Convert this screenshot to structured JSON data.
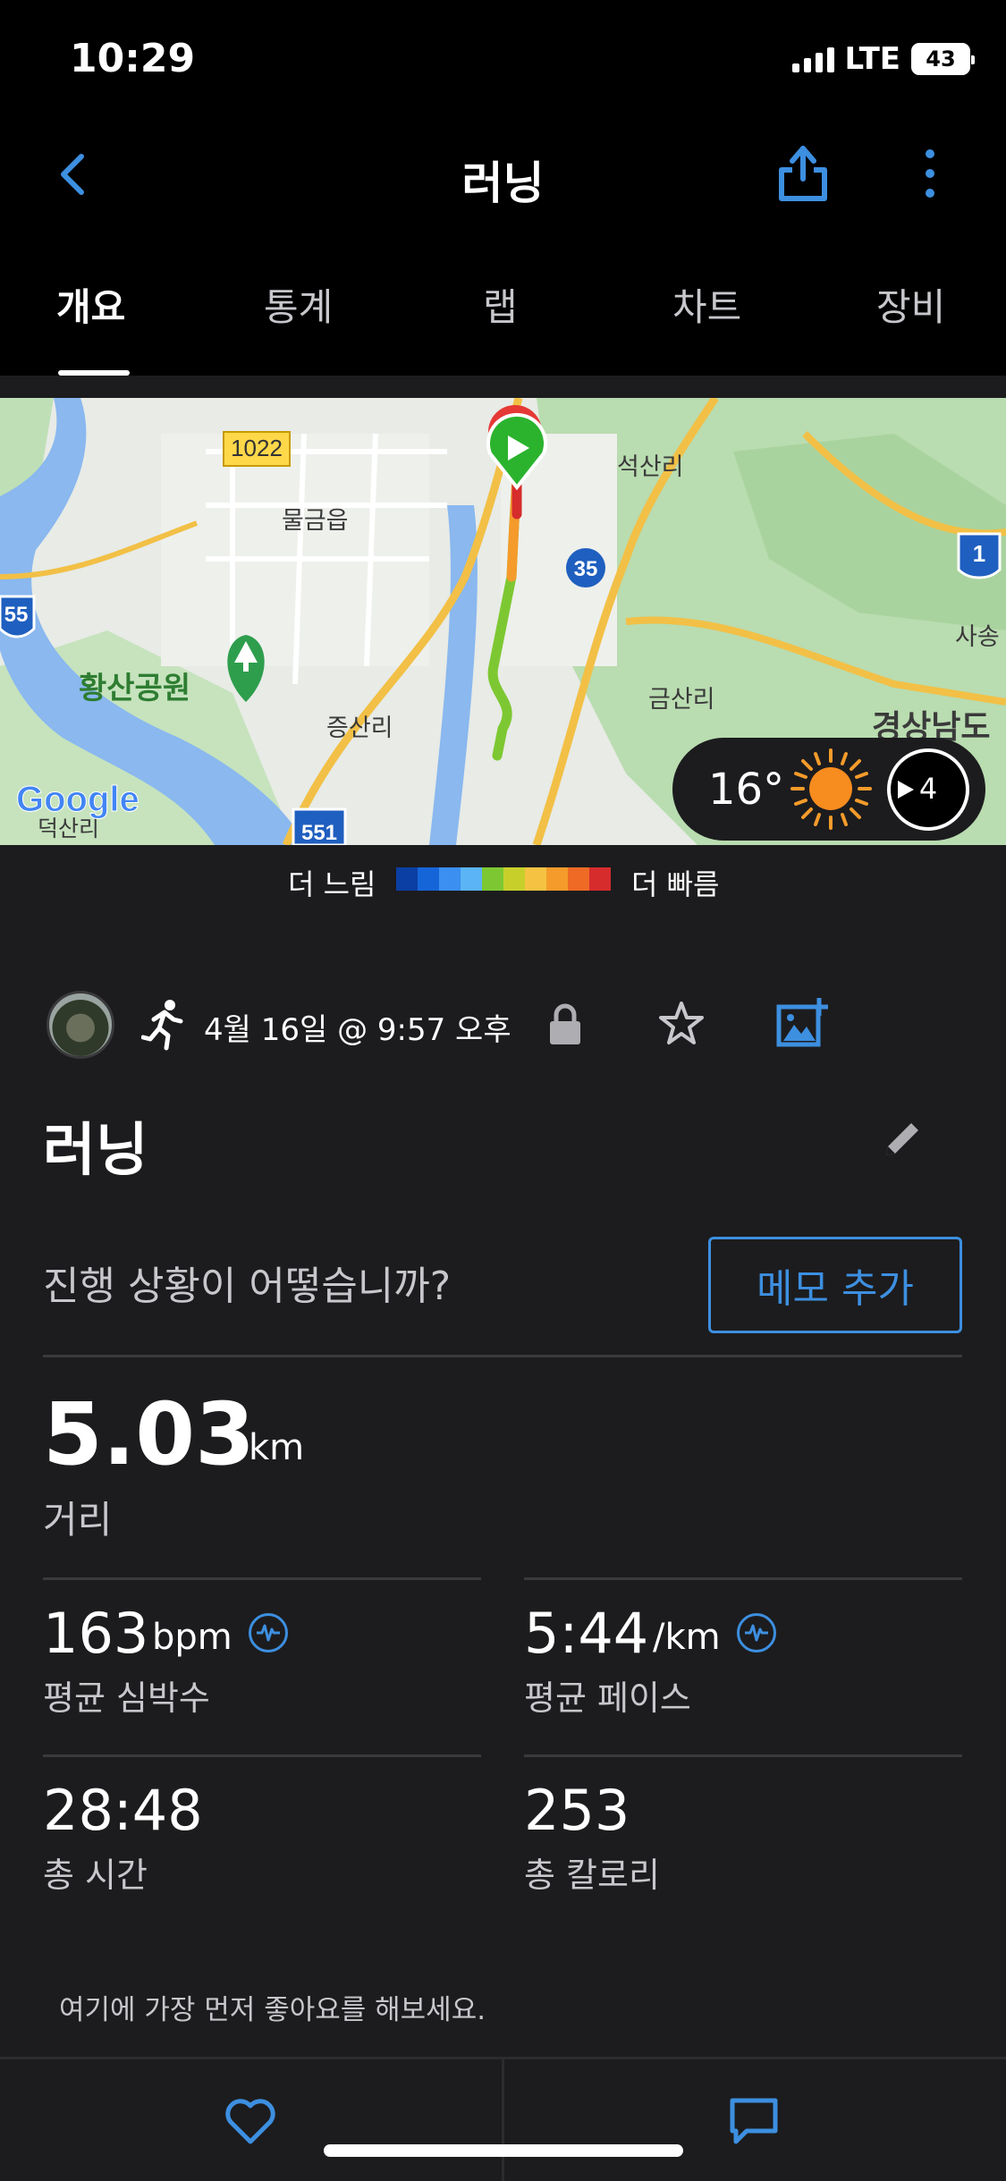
{
  "status_bar": {
    "time": "10:29",
    "network": "LTE",
    "battery": "43"
  },
  "nav": {
    "title": "러닝",
    "back_icon": "chevron-left-icon",
    "share_icon": "share-icon",
    "more_icon": "more-vertical-icon"
  },
  "tabs": [
    {
      "label": "개요",
      "active": true
    },
    {
      "label": "통계",
      "active": false
    },
    {
      "label": "랩",
      "active": false
    },
    {
      "label": "차트",
      "active": false
    },
    {
      "label": "장비",
      "active": false
    }
  ],
  "map": {
    "labels": {
      "route1022": "1022",
      "mulgeum": "물금읍",
      "seoksan": "석산리",
      "route35": "35",
      "route1": "1",
      "route55": "55",
      "sasong": "사송",
      "hwangsan": "황산공원",
      "jeungsan": "증산리",
      "geumsan": "금산리",
      "gyeongsang": "경상남도",
      "deoksan": "덕산리",
      "route551": "551",
      "google": "Google"
    },
    "weather": {
      "temp": "16°",
      "wind": "4"
    }
  },
  "legend": {
    "slow": "더 느림",
    "fast": "더 빠름",
    "colors": [
      "#0b3fa3",
      "#1665d8",
      "#3a8ff0",
      "#5ab4f5",
      "#7dc832",
      "#c7d02b",
      "#f5c242",
      "#f49b2b",
      "#ef6a25",
      "#d62c2c"
    ]
  },
  "activity": {
    "date": "4월 16일 @ 9:57 오후",
    "title": "러닝",
    "question": "진행 상황이 어떻습니까?",
    "memo_button": "메모 추가"
  },
  "stats": {
    "distance": {
      "value": "5.03",
      "unit": "km",
      "label": "거리"
    },
    "heart_rate": {
      "value": "163",
      "unit": "bpm",
      "label": "평균 심박수"
    },
    "pace": {
      "value": "5:44",
      "unit": "/km",
      "label": "평균 페이스"
    },
    "time": {
      "value": "28:48",
      "label": "총 시간"
    },
    "calories": {
      "value": "253",
      "label": "총 칼로리"
    }
  },
  "social": {
    "like_prompt": "여기에 가장 먼저 좋아요를 해보세요."
  },
  "colors": {
    "accent": "#3d8fe0",
    "background": "#1c1c1e",
    "header": "#000000"
  }
}
